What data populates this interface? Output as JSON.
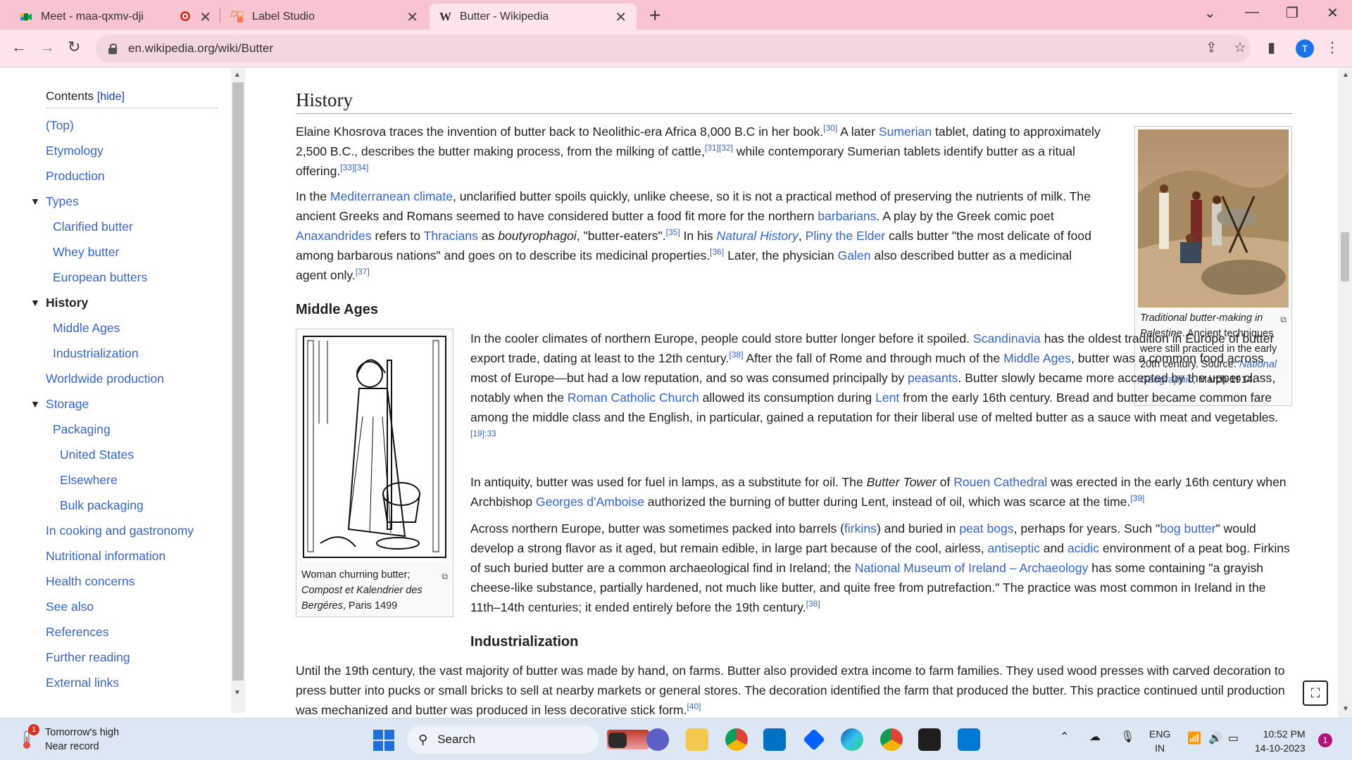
{
  "browser": {
    "tabs": [
      {
        "title": "Meet - maa-qxmv-dji",
        "icon": "google-meet-icon"
      },
      {
        "title": "Label Studio",
        "icon": "label-studio-icon"
      },
      {
        "title": "Butter - Wikipedia",
        "icon": "wikipedia-icon",
        "favicon_letter": "W"
      }
    ],
    "url": "en.wikipedia.org/wiki/Butter",
    "profile_initial": "T"
  },
  "toc": {
    "title": "Contents",
    "hide_label": "[hide]",
    "items": [
      {
        "label": "(Top)"
      },
      {
        "label": "Etymology"
      },
      {
        "label": "Production"
      },
      {
        "label": "Types"
      },
      {
        "label": "Clarified butter"
      },
      {
        "label": "Whey butter"
      },
      {
        "label": "European butters"
      },
      {
        "label": "History"
      },
      {
        "label": "Middle Ages"
      },
      {
        "label": "Industrialization"
      },
      {
        "label": "Worldwide production"
      },
      {
        "label": "Storage"
      },
      {
        "label": "Packaging"
      },
      {
        "label": "United States"
      },
      {
        "label": "Elsewhere"
      },
      {
        "label": "Bulk packaging"
      },
      {
        "label": "In cooking and gastronomy"
      },
      {
        "label": "Nutritional information"
      },
      {
        "label": "Health concerns"
      },
      {
        "label": "See also"
      },
      {
        "label": "References"
      },
      {
        "label": "Further reading"
      },
      {
        "label": "External links"
      }
    ]
  },
  "article": {
    "history_heading": "History",
    "p1": {
      "a": "Elaine Khosrova traces the invention of butter back to Neolithic-era Africa 8,000 B.C in her book.",
      "ref30": "[30]",
      "b": " A later ",
      "sumerian": "Sumerian",
      "c": " tablet, dating to approximately 2,500 B.C., describes the butter making process, from the milking of cattle,",
      "ref3132": "[31][32]",
      "d": " while contemporary Sumerian tablets identify butter as a ritual offering.",
      "ref3334": "[33][34]"
    },
    "p2": {
      "a": "In the ",
      "mediterranean": "Mediterranean climate",
      "b": ", unclarified butter spoils quickly, unlike cheese, so it is not a practical method of preserving the nutrients of milk. The ancient Greeks and Romans seemed to have considered butter a food fit more for the northern ",
      "barbarians": "barbarians",
      "c": ". A play by the Greek comic poet ",
      "anaxandrides": "Anaxandrides",
      "d": " refers to ",
      "thracians": "Thracians",
      "e": " as ",
      "boutyrophagoi": "boutyrophagoi",
      "f": ", \"butter-eaters\".",
      "ref35": "[35]",
      "g": " In his ",
      "natural_history": "Natural History",
      "h": ", ",
      "pliny": "Pliny the Elder",
      "i": " calls butter \"the most delicate of food among barbarous nations\" and goes on to describe its medicinal properties.",
      "ref36": "[36]",
      "j": " Later, the physician ",
      "galen": "Galen",
      "k": " also described butter as a medicinal agent only.",
      "ref37": "[37]"
    },
    "middle_ages_heading": "Middle Ages",
    "p3": {
      "a": "In the cooler climates of northern Europe, people could store butter longer before it spoiled. ",
      "scandinavia": "Scandinavia",
      "b": " has the oldest tradition in Europe of butter export trade, dating at least to the 12th century.",
      "ref38": "[38]",
      "c": " After the fall of Rome and through much of the ",
      "middle_ages": "Middle Ages",
      "d": ", butter was a common food across most of Europe—but had a low reputation, and so was consumed principally by ",
      "peasants": "peasants",
      "e": ". Butter slowly became more accepted by the upper class, notably when the ",
      "rcc": "Roman Catholic Church",
      "f": " allowed its consumption during ",
      "lent": "Lent",
      "g": " from the early 16th century. Bread and butter became common fare among the middle class and the English, in particular, gained a reputation for their liberal use of melted butter as a sauce with meat and vegetables.",
      "ref1933": "[19]:33"
    },
    "p4": {
      "a": "In antiquity, butter was used for fuel in lamps, as a substitute for oil. The ",
      "butter_tower": "Butter Tower",
      "b": " of ",
      "rouen": "Rouen Cathedral",
      "c": " was erected in the early 16th century when Archbishop ",
      "georges": "Georges d'Amboise",
      "d": " authorized the burning of butter during Lent, instead of oil, which was scarce at the time.",
      "ref39": "[39]"
    },
    "p5": {
      "a": "Across northern Europe, butter was sometimes packed into barrels (",
      "firkins": "firkins",
      "b": ") and buried in ",
      "peat_bogs": "peat bogs",
      "c": ", perhaps for years. Such \"",
      "bog_butter": "bog butter",
      "d": "\" would develop a strong flavor as it aged, but remain edible, in large part because of the cool, airless, ",
      "antiseptic": "antiseptic",
      "e": " and ",
      "acidic": "acidic",
      "f": " environment of a peat bog. Firkins of such buried butter are a common archaeological find in Ireland; the ",
      "museum": "National Museum of Ireland – Archaeology",
      "g": " has some containing \"a grayish cheese-like substance, partially hardened, not much like butter, and quite free from putrefaction.\" The practice was most common in Ireland in the 11th–14th centuries; it ended entirely before the 19th century.",
      "ref38b": "[38]"
    },
    "industrialization_heading": "Industrialization",
    "p6": {
      "a": "Until the 19th century, the vast majority of butter was made by hand, on farms. Butter also provided extra income to farm families. They used wood presses with carved decoration to press butter into pucks or small bricks to sell at nearby markets or general stores. The decoration identified the farm that produced the butter. This practice continued until production was mechanized and butter was produced in less decorative stick form.",
      "ref40": "[40]"
    },
    "fig_woman": {
      "cap_a": "Woman churning butter; ",
      "cap_b": "Compost et Kalendrier des Bergéres",
      "cap_c": ", Paris 1499"
    },
    "fig_palestine": {
      "cap_a": "Traditional butter-making in Palestine",
      "cap_b": ". Ancient techniques were still practiced in the early 20th century. Source: ",
      "cap_link": "National Geographic",
      "cap_c": ", March 1914."
    }
  },
  "taskbar": {
    "weather_line1": "Tomorrow's high",
    "weather_line2": "Near record",
    "weather_badge": "1",
    "search_label": "Search",
    "lang1": "ENG",
    "lang2": "IN",
    "time": "10:52 PM",
    "date": "14-10-2023",
    "notifications": "1"
  }
}
